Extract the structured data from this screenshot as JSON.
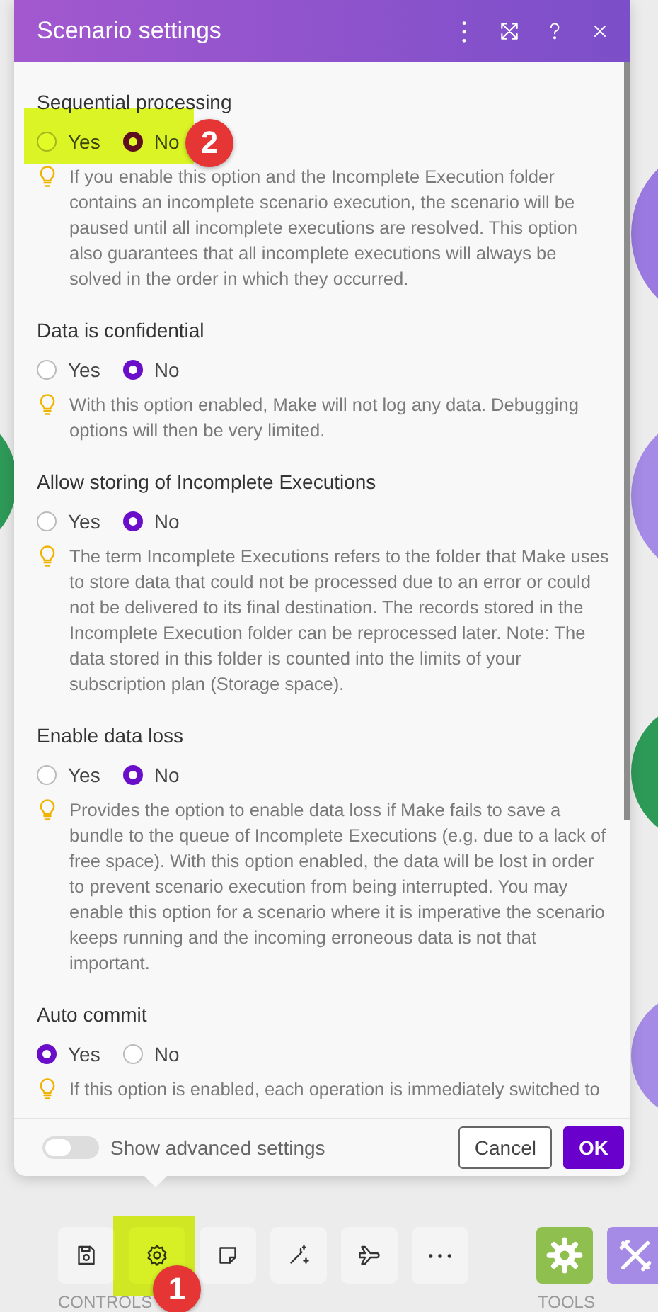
{
  "dialog": {
    "title": "Scenario settings"
  },
  "settings": [
    {
      "label": "Sequential processing",
      "options": [
        {
          "label": "Yes",
          "selected": false
        },
        {
          "label": "No",
          "selected": true
        }
      ],
      "hint": "If you enable this option and the Incomplete Execution folder contains an incomplete scenario execution, the scenario will be paused until all incomplete executions are resolved. This option also guarantees that all incomplete executions will always be solved in the order in which they occurred."
    },
    {
      "label": "Data is confidential",
      "options": [
        {
          "label": "Yes",
          "selected": false
        },
        {
          "label": "No",
          "selected": true
        }
      ],
      "hint": "With this option enabled, Make will not log any data. Debugging options will then be very limited."
    },
    {
      "label": "Allow storing of Incomplete Executions",
      "options": [
        {
          "label": "Yes",
          "selected": false
        },
        {
          "label": "No",
          "selected": true
        }
      ],
      "hint": "The term Incomplete Executions refers to the folder that Make uses to store data that could not be processed due to an error or could not be delivered to its final destination. The records stored in the Incomplete Execution folder can be reprocessed later. Note: The data stored in this folder is counted into the limits of your subscription plan (Storage space)."
    },
    {
      "label": "Enable data loss",
      "options": [
        {
          "label": "Yes",
          "selected": false
        },
        {
          "label": "No",
          "selected": true
        }
      ],
      "hint": "Provides the option to enable data loss if Make fails to save a bundle to the queue of Incomplete Executions (e.g. due to a lack of free space). With this option enabled, the data will be lost in order to prevent scenario execution from being interrupted. You may enable this option for a scenario where it is imperative the scenario keeps running and the incoming erroneous data is not that important."
    },
    {
      "label": "Auto commit",
      "options": [
        {
          "label": "Yes",
          "selected": true
        },
        {
          "label": "No",
          "selected": false
        }
      ],
      "hint": "If this option is enabled, each operation is immediately switched to"
    }
  ],
  "footer": {
    "toggle": {
      "label": "Show advanced settings",
      "on": false
    },
    "buttons": [
      {
        "label": "Cancel",
        "kind": "secondary"
      },
      {
        "label": "OK",
        "kind": "primary"
      }
    ]
  },
  "toolbar": {
    "controls_label": "CONTROLS",
    "tools_label": "TOOLS"
  },
  "annotations": [
    {
      "text": "2"
    },
    {
      "text": "1"
    }
  ]
}
